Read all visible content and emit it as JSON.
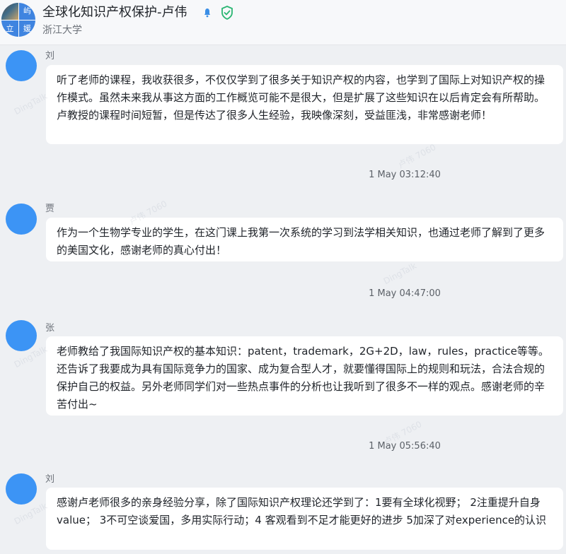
{
  "header": {
    "title": "全球化知识产权保护-卢伟",
    "subtitle": "浙江大学",
    "avatar_chars": [
      "屿",
      "立",
      "媛"
    ]
  },
  "watermark_text": [
    "DingTalk",
    "卢伟 7060"
  ],
  "messages": [
    {
      "sender": "刘",
      "text": "听了老师的课程，我收获很多，不仅仅学到了很多关于知识产权的内容，也学到了国际上对知识产权的操作模式。虽然未来我从事这方面的工作概览可能不是很大，但是扩展了这些知识在以后肯定会有所帮助。卢教授的课程时间短暂，但是传达了很多人生经验，我映像深刻，受益匪浅，非常感谢老师！",
      "time": "1 May 03:12:40"
    },
    {
      "sender": "贾",
      "text": "作为一个生物学专业的学生，在这门课上我第一次系统的学习到法学相关知识，也通过老师了解到了更多的美国文化，感谢老师的真心付出！",
      "time": "1 May 04:47:00"
    },
    {
      "sender": "张",
      "text": "老师教给了我国际知识产权的基本知识：patent，trademark，2G+2D，law，rules，practice等等。还告诉了我要成为具有国际竞争力的国家、成为复合型人才，就要懂得国际上的规则和玩法，合法合规的保护自己的权益。另外老师同学们对一些热点事件的分析也让我听到了很多不一样的观点。感谢老师的辛苦付出~",
      "time": "1 May 05:56:40"
    },
    {
      "sender": "刘",
      "text": "感谢卢老师很多的亲身经验分享，除了国际知识产权理论还学到了：1要有全球化视野； 2注重提升自身value； 3不可空谈爱国，多用实际行动；4 客观看到不足才能更好的进步 5加深了对experience的认识",
      "time": ""
    }
  ],
  "colors": {
    "avatar": "#3c94f5",
    "verified": "#2bb673",
    "bell": "#3a8ee6"
  }
}
